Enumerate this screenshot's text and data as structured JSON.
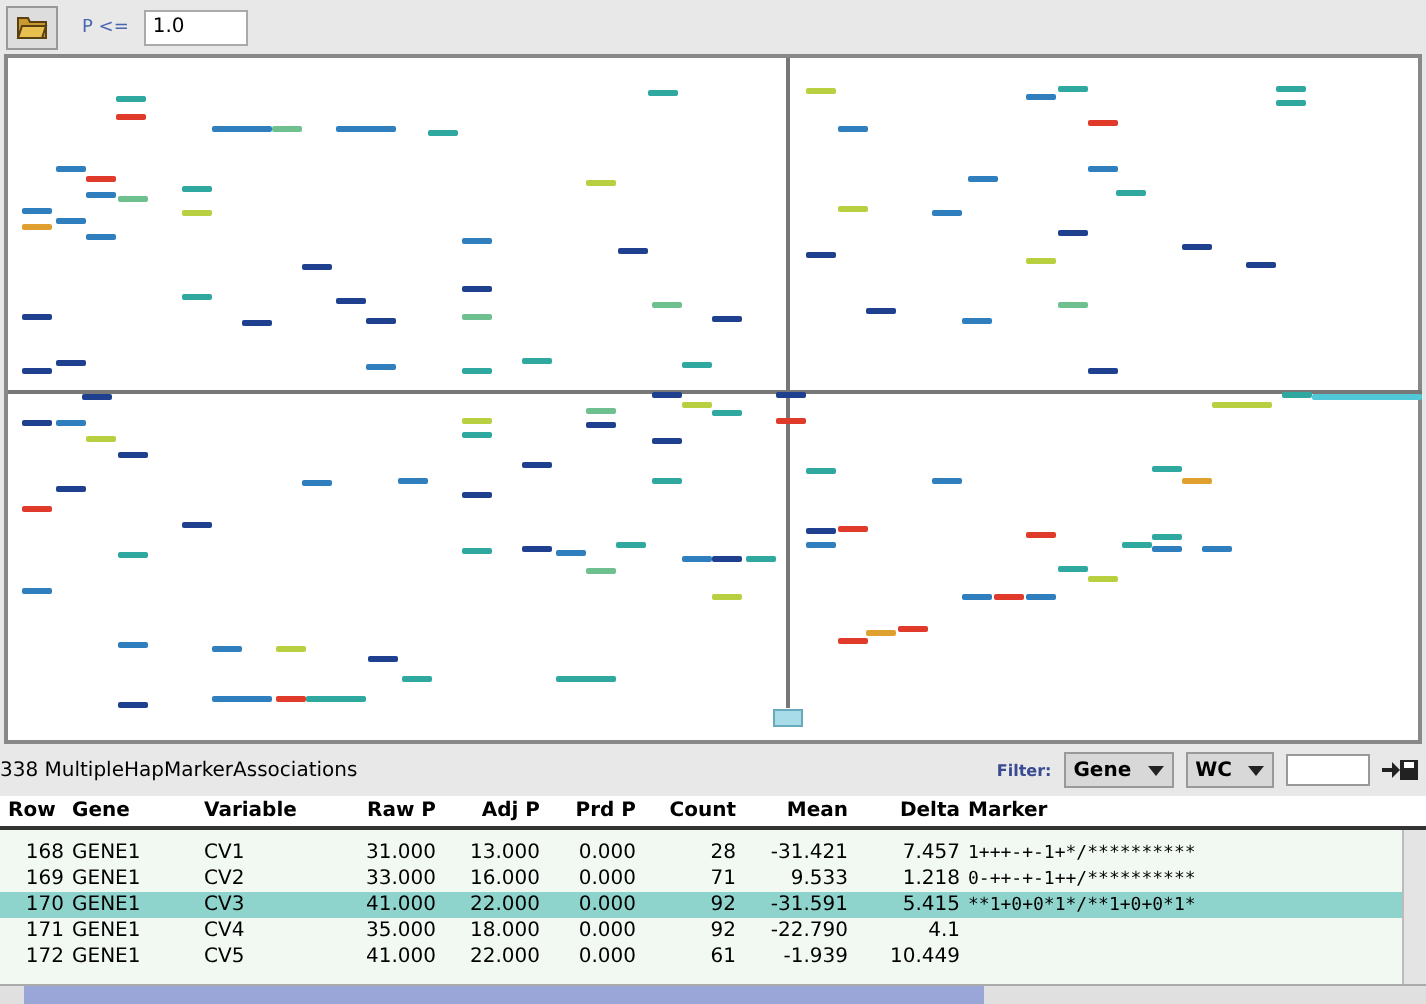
{
  "toolbar": {
    "p_label": "P <=",
    "p_value": "1.0"
  },
  "results": {
    "title": "338 MultipleHapMarkerAssociations",
    "filter_label": "Filter:",
    "dropdowns": [
      "Gene",
      "WC"
    ]
  },
  "table": {
    "columns": [
      "Row",
      "Gene",
      "Variable",
      "Raw P",
      "Adj P",
      "Prd P",
      "Count",
      "Mean",
      "Delta",
      "Marker"
    ],
    "rows": [
      {
        "selected": false,
        "cells": [
          "168",
          "GENE1",
          "CV1",
          "31.000",
          "13.000",
          "0.000",
          "28",
          "-31.421",
          "7.457",
          "1+++-+-1+*/**********"
        ]
      },
      {
        "selected": false,
        "cells": [
          "169",
          "GENE1",
          "CV2",
          "33.000",
          "16.000",
          "0.000",
          "71",
          "9.533",
          "1.218",
          "0-++-+-1++/**********"
        ]
      },
      {
        "selected": true,
        "cells": [
          "170",
          "GENE1",
          "CV3",
          "41.000",
          "22.000",
          "0.000",
          "92",
          "-31.591",
          "5.415",
          "**1+0+0*1*/**1+0+0*1*"
        ]
      },
      {
        "selected": false,
        "cells": [
          "171",
          "GENE1",
          "CV4",
          "35.000",
          "18.000",
          "0.000",
          "92",
          "-22.790",
          "4.1",
          ""
        ]
      },
      {
        "selected": false,
        "cells": [
          "172",
          "GENE1",
          "CV5",
          "41.000",
          "22.000",
          "0.000",
          "61",
          "-1.939",
          "10.449",
          ""
        ]
      }
    ]
  }
}
